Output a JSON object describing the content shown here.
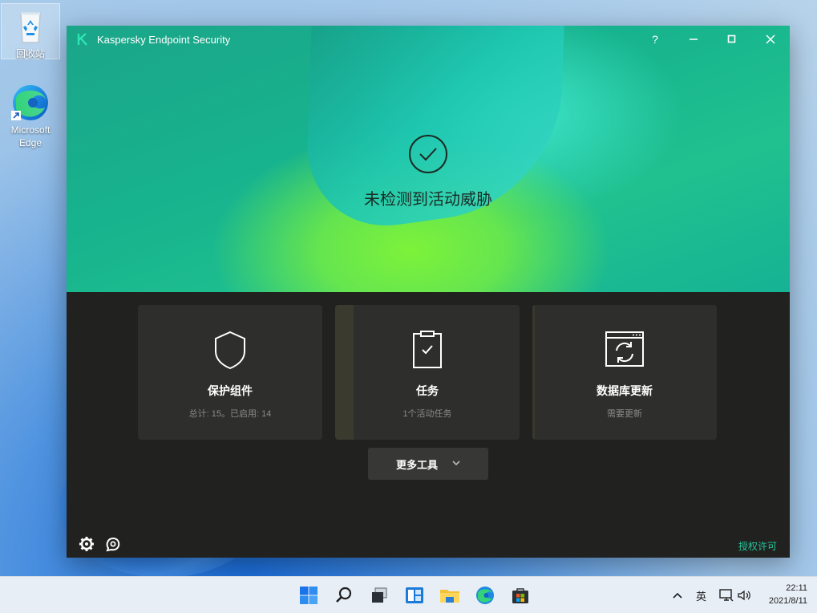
{
  "desktop": {
    "icons": [
      {
        "label": "回收站",
        "icon": "recycle-bin-icon"
      },
      {
        "label_line1": "Microsoft",
        "label_line2": "Edge",
        "icon": "edge-icon"
      }
    ]
  },
  "window": {
    "title": "Kaspersky Endpoint Security",
    "buttons": {
      "help": "?",
      "minimize": "minimize-icon",
      "maximize": "maximize-icon",
      "close": "close-icon"
    },
    "status_text": "未检测到活动威胁",
    "cards": [
      {
        "title": "保护组件",
        "subtitle": "总计: 15。已启用: 14",
        "icon": "shield-icon"
      },
      {
        "title": "任务",
        "subtitle": "1个活动任务",
        "icon": "clipboard-check-icon"
      },
      {
        "title": "数据库更新",
        "subtitle": "需要更新",
        "icon": "database-update-icon"
      }
    ],
    "more_tools": "更多工具",
    "license_link": "授权许可",
    "colors": {
      "accent": "#26c79a",
      "panel": "#212120",
      "card": "#2e2e2d"
    }
  },
  "taskbar": {
    "apps": [
      "start-icon",
      "search-icon",
      "task-view-icon",
      "widgets-icon",
      "file-explorer-icon",
      "edge-icon",
      "store-icon"
    ],
    "ime": "英",
    "time": "22:11",
    "date": "2021/8/11"
  }
}
